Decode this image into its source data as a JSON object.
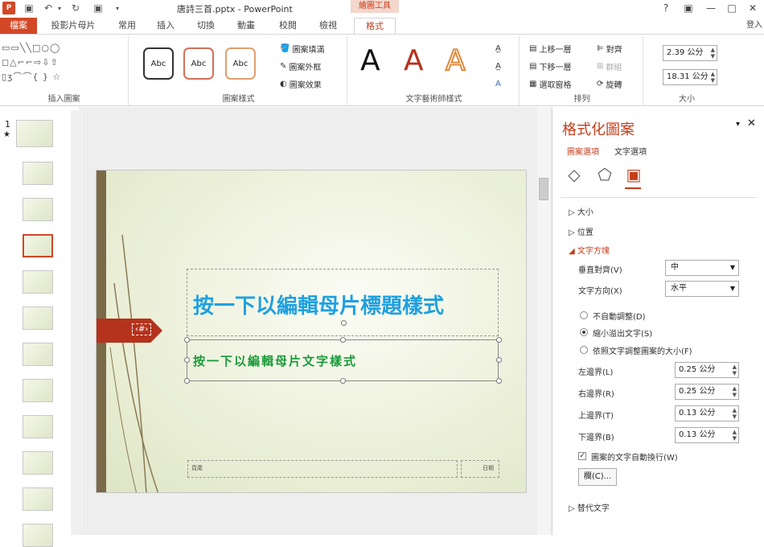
{
  "window": {
    "title": "唐詩三首.pptx - PowerPoint",
    "contextual_tab": "繪圖工具",
    "help": "?",
    "restore": "▣",
    "minimize": "—",
    "maximize": "□",
    "close": "✕",
    "signin": "登入",
    "qa_icons": {
      "app": "P",
      "save": "▣",
      "undo": "↶",
      "undo_drop": "▾",
      "redo": "↻",
      "present": "▣",
      "customize": "▾"
    }
  },
  "tabs": [
    "檔案",
    "投影片母片",
    "常用",
    "插入",
    "切換",
    "動畫",
    "校閱",
    "檢視",
    "格式"
  ],
  "ribbon": {
    "insert_shapes": {
      "label": "插入圖案",
      "shapes": "▭▭╲╲□○◯\n◻△⌐⌐⇨⇩⇧\n▯ʒ⌒⌒{ } ☆"
    },
    "shape_styles": {
      "label": "圖案樣式",
      "samples": [
        "Abc",
        "Abc",
        "Abc"
      ],
      "fill": "圖案填滿",
      "outline": "圖案外框",
      "effects": "圖案效果"
    },
    "wordart": {
      "label": "文字藝術師樣式",
      "letters": [
        "A",
        "A",
        "A"
      ]
    },
    "arrange": {
      "label": "排列",
      "bring_forward": "上移一層",
      "send_backward": "下移一層",
      "selection_pane": "選取窗格",
      "align": "對齊",
      "group": "群組",
      "rotate": "旋轉"
    },
    "size": {
      "label": "大小",
      "height": "2.39 公分",
      "width": "18.31 公分"
    }
  },
  "thumbs": {
    "num": "1",
    "star": "★",
    "count": 12,
    "selected": 3
  },
  "slide": {
    "title": "按一下以編輯母片標題樣式",
    "subtitle": "按一下以編輯母片文字樣式",
    "number": "‹#›",
    "footer": "頁尾",
    "date": "日期"
  },
  "pane": {
    "title": "格式化圖案",
    "tab_shape": "圖案選項",
    "tab_text": "文字選項",
    "icons": [
      "fill-icon",
      "pentagon-icon",
      "textbox-icon"
    ],
    "sections": {
      "size": "大小",
      "position": "位置",
      "textbox": "文字方塊",
      "alt_text": "替代文字"
    },
    "vertical_align_label": "垂直對齊(V)",
    "vertical_align_value": "中",
    "text_direction_label": "文字方向(X)",
    "text_direction_value": "水平",
    "radio1": "不自動調整(D)",
    "radio2": "縮小溢出文字(S)",
    "radio3": "依照文字調整圖案的大小(F)",
    "left_margin_label": "左邊界(L)",
    "left_margin": "0.25 公分",
    "right_margin_label": "右邊界(R)",
    "right_margin": "0.25 公分",
    "top_margin_label": "上邊界(T)",
    "top_margin": "0.13 公分",
    "bottom_margin_label": "下邊界(B)",
    "bottom_margin": "0.13 公分",
    "wrap_label": "圖案的文字自動換行(W)",
    "columns_button": "欄(C)...",
    "pin": "▾",
    "close": "✕"
  },
  "colors": {
    "accent": "#d24726",
    "title_blue": "#1fa0e0",
    "subtitle_green": "#1a9a3a"
  }
}
